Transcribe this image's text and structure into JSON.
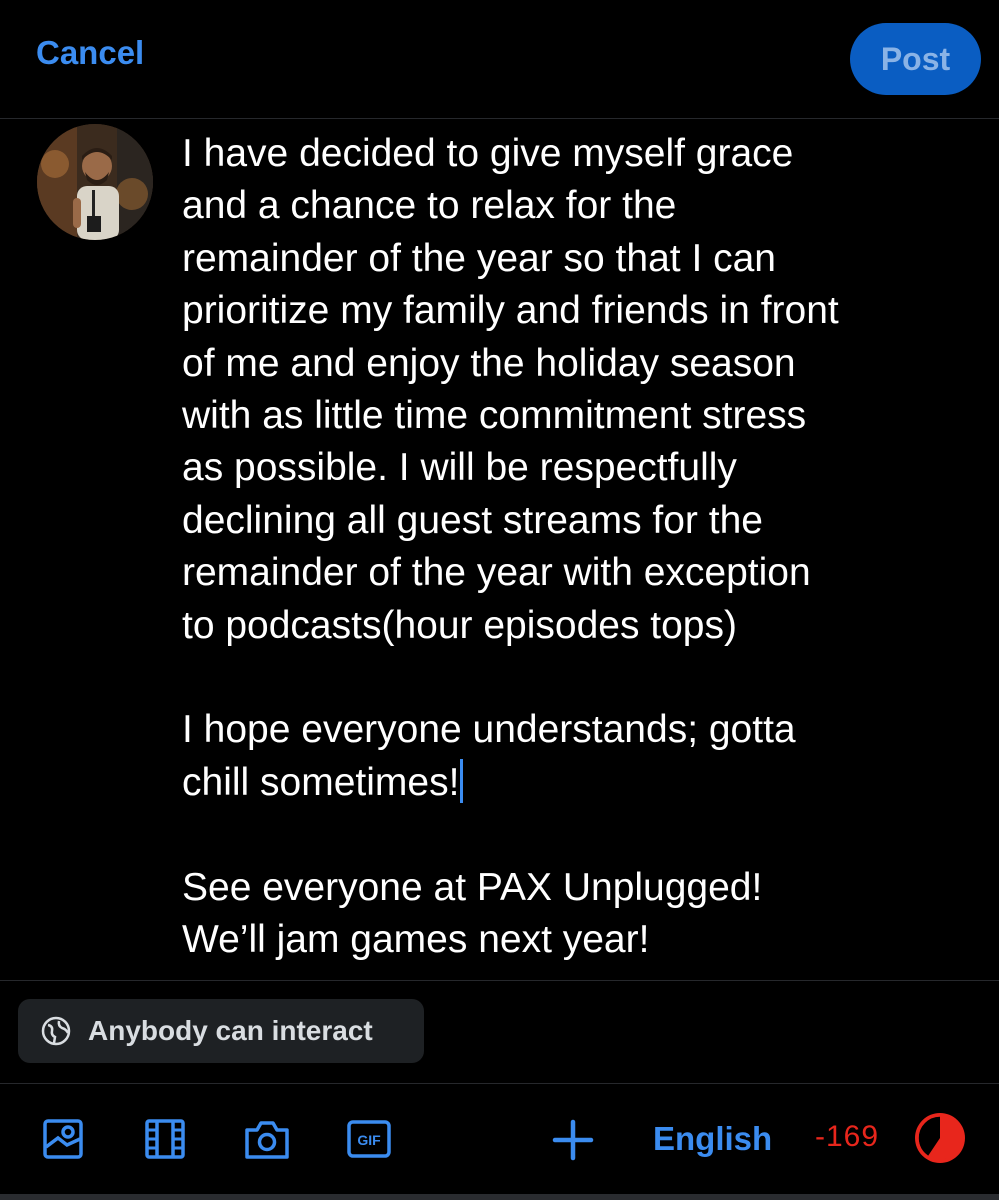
{
  "header": {
    "cancel_label": "Cancel",
    "post_label": "Post"
  },
  "compose": {
    "text": "I have decided to give myself grace\nand a chance to relax for the\nremainder of the year so that I can\nprioritize my family and friends in front\nof me and enjoy the holiday season\nwith as little time commitment stress\nas possible. I will be respectfully\ndeclining all guest streams for the\nremainder of the year with exception\nto podcasts(hour episodes tops)\n\nI hope everyone understands; gotta\nchill sometimes!",
    "text_after_caret": "\n\nSee everyone at PAX Unplugged!\nWe’ll jam games next year!"
  },
  "audience": {
    "label": "Anybody can interact",
    "icon": "globe-icon"
  },
  "toolbar": {
    "icons": [
      "image-icon",
      "film-icon",
      "camera-icon",
      "gif-icon",
      "plus-icon"
    ],
    "gif_label": "GIF",
    "language": "English",
    "char_count": "-169"
  },
  "colors": {
    "accent": "#3b8cf0",
    "post_button_bg": "#0a5dc2",
    "over_limit": "#e8261c",
    "background": "#000000",
    "chip_bg": "#1e2124"
  }
}
